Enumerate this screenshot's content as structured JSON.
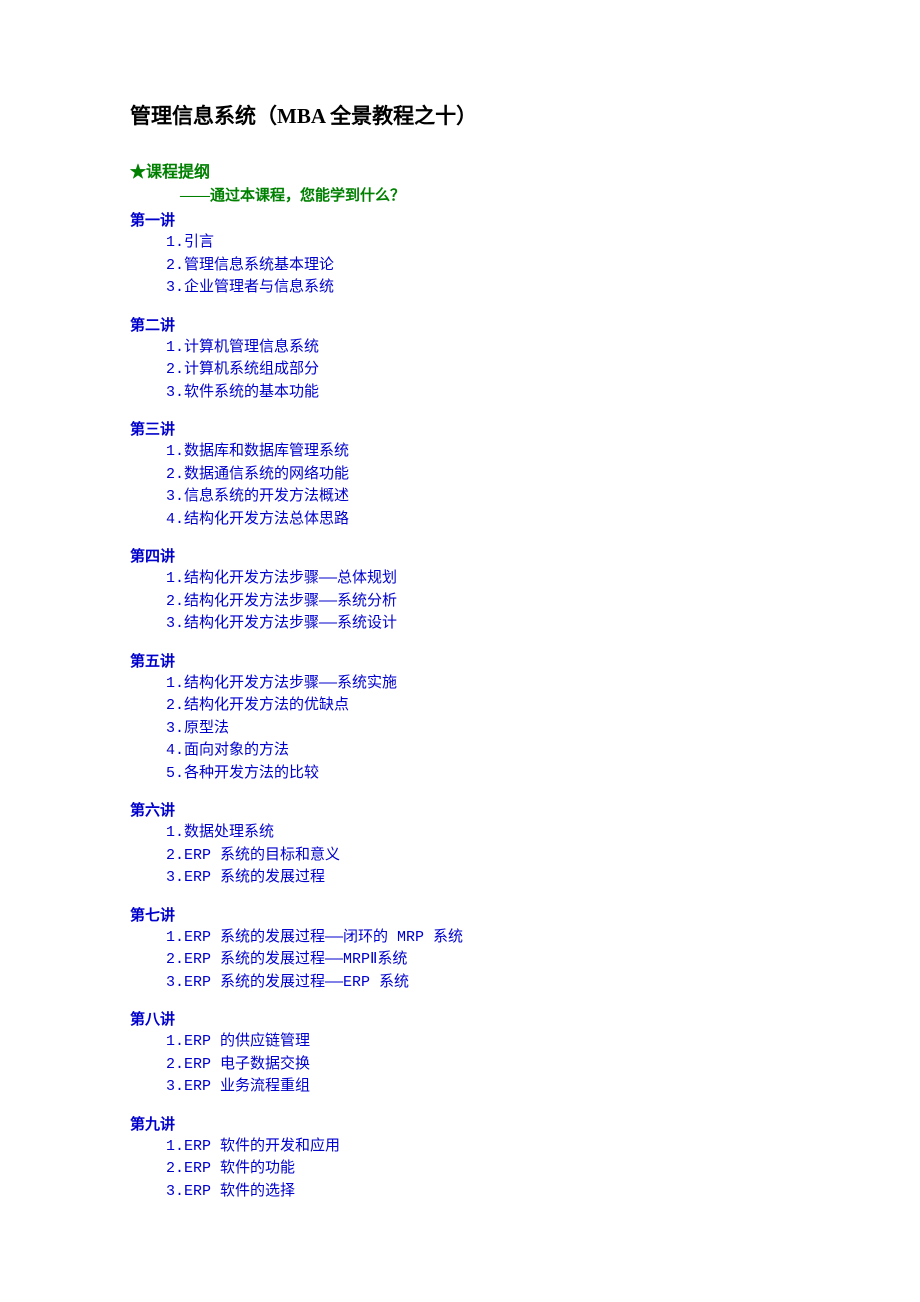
{
  "title": "管理信息系统（MBA 全景教程之十）",
  "outline_star": "★",
  "outline_header": "课程提纲",
  "subheader": "——通过本课程，您能学到什么？",
  "lectures": [
    {
      "heading": "第一讲",
      "items": [
        "1.引言",
        "2.管理信息系统基本理论",
        "3.企业管理者与信息系统"
      ]
    },
    {
      "heading": "第二讲",
      "items": [
        "1.计算机管理信息系统",
        "2.计算机系统组成部分",
        "3.软件系统的基本功能"
      ]
    },
    {
      "heading": "第三讲",
      "items": [
        "1.数据库和数据库管理系统",
        "2.数据通信系统的网络功能",
        "3.信息系统的开发方法概述",
        "4.结构化开发方法总体思路"
      ]
    },
    {
      "heading": "第四讲",
      "items": [
        "1.结构化开发方法步骤——总体规划",
        "2.结构化开发方法步骤——系统分析",
        "3.结构化开发方法步骤——系统设计"
      ]
    },
    {
      "heading": "第五讲",
      "items": [
        "1.结构化开发方法步骤——系统实施",
        "2.结构化开发方法的优缺点",
        "3.原型法",
        "4.面向对象的方法",
        "5.各种开发方法的比较"
      ]
    },
    {
      "heading": "第六讲",
      "items": [
        "1.数据处理系统",
        "2.ERP 系统的目标和意义",
        "3.ERP 系统的发展过程"
      ]
    },
    {
      "heading": "第七讲",
      "items": [
        "1.ERP 系统的发展过程——闭环的 MRP 系统",
        "2.ERP 系统的发展过程——MRPⅡ系统",
        "3.ERP 系统的发展过程——ERP 系统"
      ]
    },
    {
      "heading": "第八讲",
      "items": [
        "1.ERP 的供应链管理",
        "2.ERP 电子数据交换",
        "3.ERP 业务流程重组"
      ]
    },
    {
      "heading": "第九讲",
      "items": [
        "1.ERP 软件的开发和应用",
        "2.ERP 软件的功能",
        "3.ERP 软件的选择"
      ]
    }
  ]
}
